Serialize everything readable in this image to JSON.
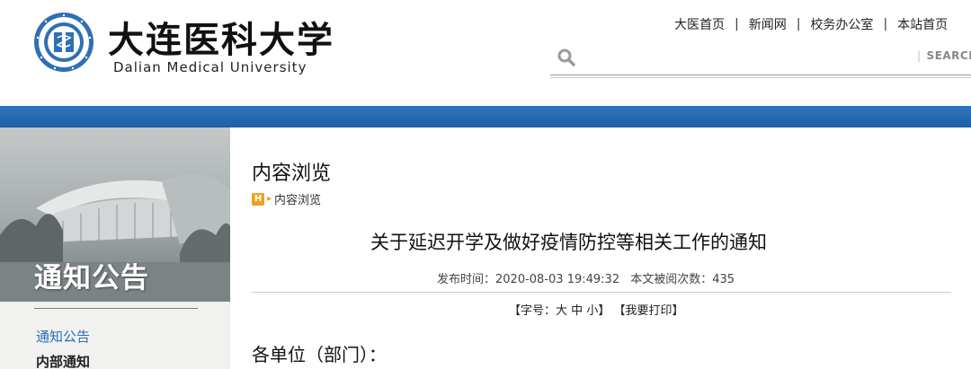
{
  "header": {
    "logo_cn": "大连医科大学",
    "logo_en": "Dalian Medical University",
    "top_links": [
      "大医首页",
      "新闻网",
      "校务办公室",
      "本站首页"
    ],
    "search_placeholder": "",
    "search_button": "SEARCH",
    "accent_color": "#1f5fa6"
  },
  "sidebar": {
    "banner_title": "通知公告",
    "items": [
      {
        "label": "通知公告",
        "active": true
      },
      {
        "label": "内部通知",
        "active": false
      }
    ]
  },
  "main": {
    "page_title": "内容浏览",
    "breadcrumb": {
      "icon_label": "H",
      "text": "内容浏览"
    },
    "article_title": "关于延迟开学及做好疫情防控等相关工作的通知",
    "meta": {
      "publish_label": "发布时间：",
      "publish_time": "2020-08-03 19:49:32",
      "views_label": "本文被阅次数：",
      "views": "435"
    },
    "tools": {
      "font_size_label": "【字号：",
      "size_large": "大",
      "size_medium": "中",
      "size_small": "小",
      "font_size_end": "】",
      "print_label": "【我要打印】"
    },
    "body_start": "各单位（部门）："
  }
}
